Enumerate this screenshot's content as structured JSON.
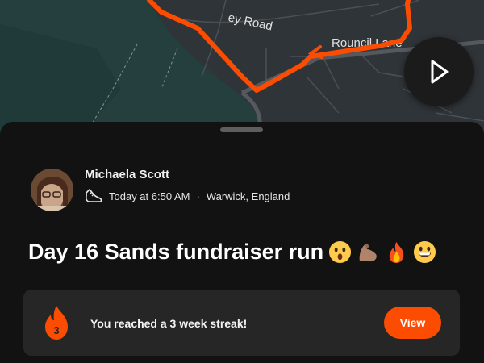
{
  "map": {
    "road_labels": [
      "ey Road",
      "Rouncil Lane"
    ],
    "route_color": "#fc4c02"
  },
  "map_controls": {
    "play_icon": "play-icon"
  },
  "activity": {
    "athlete_name": "Michaela Scott",
    "activity_type_icon": "shoe-icon",
    "timestamp": "Today at 6:50 AM",
    "separator": "·",
    "location": "Warwick, England",
    "title": "Day 16 Sands fundraiser run",
    "title_emojis": [
      "astonished-face-emoji",
      "flexed-biceps-emoji",
      "fire-emoji",
      "grinning-face-emoji"
    ]
  },
  "streak": {
    "icon": "flame-icon",
    "count": "3",
    "message": "You reached a 3 week streak!",
    "button_label": "View"
  },
  "colors": {
    "accent": "#fc4c02",
    "background": "#121212",
    "card": "#262626",
    "map_base": "#2f3438"
  }
}
